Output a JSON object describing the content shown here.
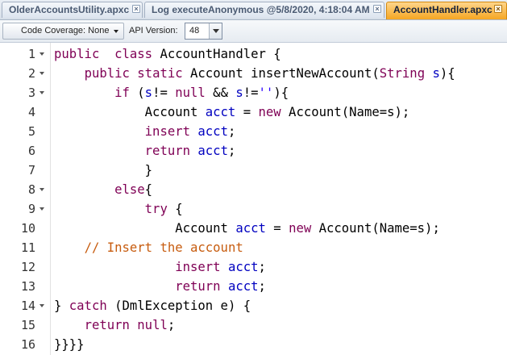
{
  "tabs": [
    {
      "label": "OlderAccountsUtility.apxc",
      "active": false,
      "close_glyph": "×"
    },
    {
      "label": "Log executeAnonymous @5/8/2020, 4:18:04 AM",
      "active": false,
      "close_glyph": "×"
    },
    {
      "label": "AccountHandler.apxc",
      "active": true,
      "close_glyph": "×"
    }
  ],
  "toolbar": {
    "coverage_label": "Code Coverage: None",
    "api_label": "API Version:",
    "api_value": "48"
  },
  "editor": {
    "lines": [
      {
        "num": "1",
        "fold": true,
        "tokens": [
          [
            "kw",
            "public"
          ],
          [
            "",
            "  "
          ],
          [
            "kw",
            "class"
          ],
          [
            "",
            " AccountHandler {"
          ]
        ]
      },
      {
        "num": "2",
        "fold": true,
        "tokens": [
          [
            "",
            "    "
          ],
          [
            "kw",
            "public"
          ],
          [
            "",
            " "
          ],
          [
            "kw",
            "static"
          ],
          [
            "",
            " Account insertNewAccount("
          ],
          [
            "ty",
            "String"
          ],
          [
            "",
            " "
          ],
          [
            "id",
            "s"
          ],
          [
            "",
            "){"
          ]
        ]
      },
      {
        "num": "3",
        "fold": true,
        "tokens": [
          [
            "",
            "        "
          ],
          [
            "kw",
            "if"
          ],
          [
            "",
            " ("
          ],
          [
            "id",
            "s"
          ],
          [
            "",
            "!= "
          ],
          [
            "kw",
            "null"
          ],
          [
            "",
            " && "
          ],
          [
            "id",
            "s"
          ],
          [
            "",
            "!="
          ],
          [
            "st",
            "''"
          ],
          [
            "",
            "){"
          ]
        ]
      },
      {
        "num": "4",
        "fold": false,
        "tokens": [
          [
            "",
            "            Account "
          ],
          [
            "id",
            "acct"
          ],
          [
            "",
            " = "
          ],
          [
            "kw",
            "new"
          ],
          [
            "",
            " Account(Name=s);"
          ]
        ]
      },
      {
        "num": "5",
        "fold": false,
        "tokens": [
          [
            "",
            "            "
          ],
          [
            "kw",
            "insert"
          ],
          [
            "",
            " "
          ],
          [
            "id",
            "acct"
          ],
          [
            "",
            ";"
          ]
        ]
      },
      {
        "num": "6",
        "fold": false,
        "tokens": [
          [
            "",
            "            "
          ],
          [
            "kw",
            "return"
          ],
          [
            "",
            " "
          ],
          [
            "id",
            "acct"
          ],
          [
            "",
            ";"
          ]
        ]
      },
      {
        "num": "7",
        "fold": false,
        "tokens": [
          [
            "",
            "            }"
          ]
        ]
      },
      {
        "num": "8",
        "fold": true,
        "tokens": [
          [
            "",
            "        "
          ],
          [
            "kw",
            "else"
          ],
          [
            "",
            "{"
          ]
        ]
      },
      {
        "num": "9",
        "fold": true,
        "tokens": [
          [
            "",
            "            "
          ],
          [
            "kw",
            "try"
          ],
          [
            "",
            " {"
          ]
        ]
      },
      {
        "num": "10",
        "fold": false,
        "tokens": [
          [
            "",
            "                Account "
          ],
          [
            "id",
            "acct"
          ],
          [
            "",
            " = "
          ],
          [
            "kw",
            "new"
          ],
          [
            "",
            " Account(Name=s);"
          ]
        ]
      },
      {
        "num": "11",
        "fold": false,
        "tokens": [
          [
            "",
            "    "
          ],
          [
            "cm",
            "// Insert the account"
          ]
        ]
      },
      {
        "num": "12",
        "fold": false,
        "tokens": [
          [
            "",
            "                "
          ],
          [
            "kw",
            "insert"
          ],
          [
            "",
            " "
          ],
          [
            "id",
            "acct"
          ],
          [
            "",
            ";"
          ]
        ]
      },
      {
        "num": "13",
        "fold": false,
        "tokens": [
          [
            "",
            "                "
          ],
          [
            "kw",
            "return"
          ],
          [
            "",
            " "
          ],
          [
            "id",
            "acct"
          ],
          [
            "",
            ";"
          ]
        ]
      },
      {
        "num": "14",
        "fold": true,
        "tokens": [
          [
            "",
            "} "
          ],
          [
            "kw",
            "catch"
          ],
          [
            "",
            " (DmlException e) {"
          ]
        ]
      },
      {
        "num": "15",
        "fold": false,
        "tokens": [
          [
            "",
            "    "
          ],
          [
            "kw",
            "return"
          ],
          [
            "",
            " "
          ],
          [
            "kw",
            "null"
          ],
          [
            "",
            ";"
          ]
        ]
      },
      {
        "num": "16",
        "fold": false,
        "tokens": [
          [
            "",
            "}}}}"
          ]
        ]
      }
    ]
  },
  "colors": {
    "active_tab": "#f5a623",
    "keyword": "#7f0055",
    "identifier": "#0000c0",
    "string": "#2a00ff",
    "comment": "#c75c0f"
  }
}
